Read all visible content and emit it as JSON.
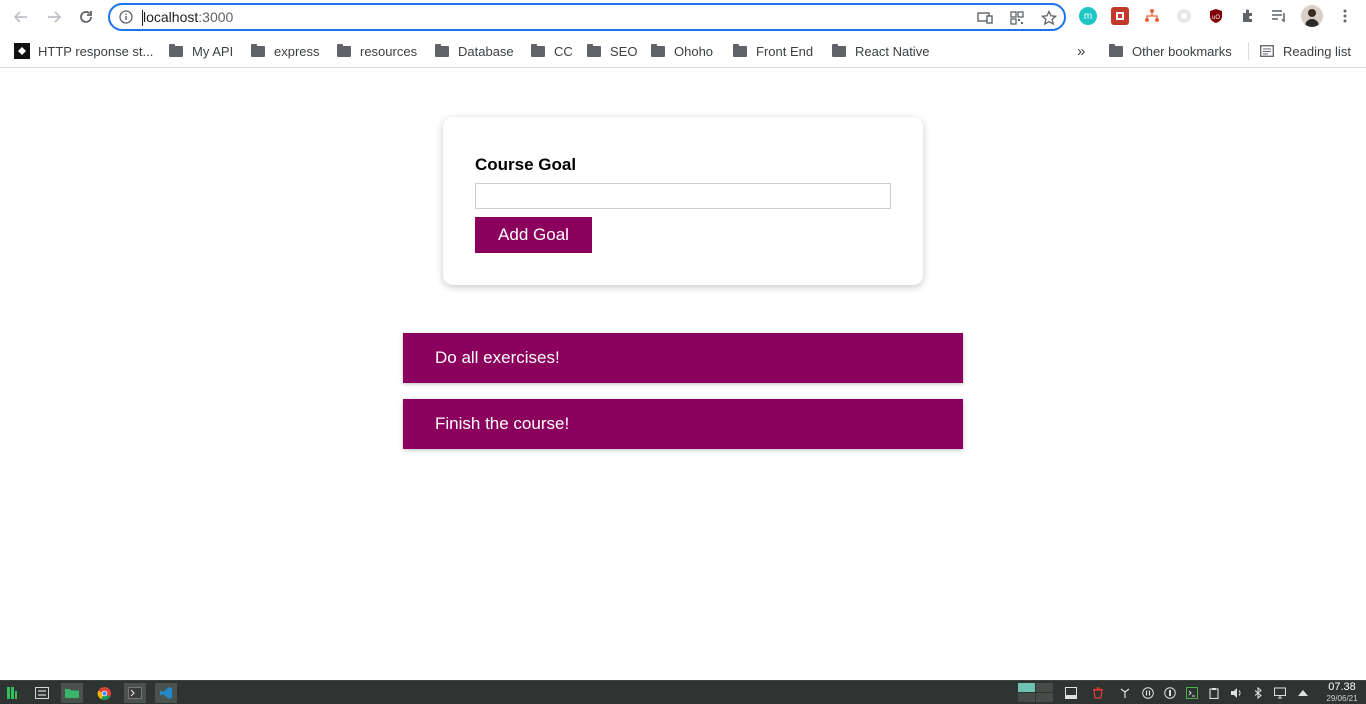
{
  "browser": {
    "url_host": "localhost",
    "url_port": ":3000",
    "icons": [
      "back-icon",
      "forward-icon",
      "reload-icon",
      "site-info-icon",
      "cast-icon",
      "qr-code-icon",
      "bookmark-star-icon",
      "extensions-puzzle-icon",
      "reading-queue-icon",
      "profile-avatar",
      "kebab-menu-icon"
    ]
  },
  "bookmarks": {
    "items": [
      {
        "label": "HTTP response st..."
      },
      {
        "label": "My API"
      },
      {
        "label": "express"
      },
      {
        "label": "resources"
      },
      {
        "label": "Database"
      },
      {
        "label": "CC"
      },
      {
        "label": "SEO"
      },
      {
        "label": "Ohoho"
      },
      {
        "label": "Front End"
      },
      {
        "label": "React Native"
      }
    ],
    "overflow": "»",
    "other": "Other bookmarks",
    "reading_list": "Reading list"
  },
  "form": {
    "label": "Course Goal",
    "input_value": "",
    "button_label": "Add Goal"
  },
  "goals": [
    {
      "text": "Do all exercises!"
    },
    {
      "text": "Finish the course!"
    }
  ],
  "colors": {
    "accent": "#8b005d",
    "omnibox_focus": "#1a73e8",
    "taskbar": "#2e3432"
  },
  "taskbar": {
    "time": "07.38",
    "date": "29/06/21"
  }
}
